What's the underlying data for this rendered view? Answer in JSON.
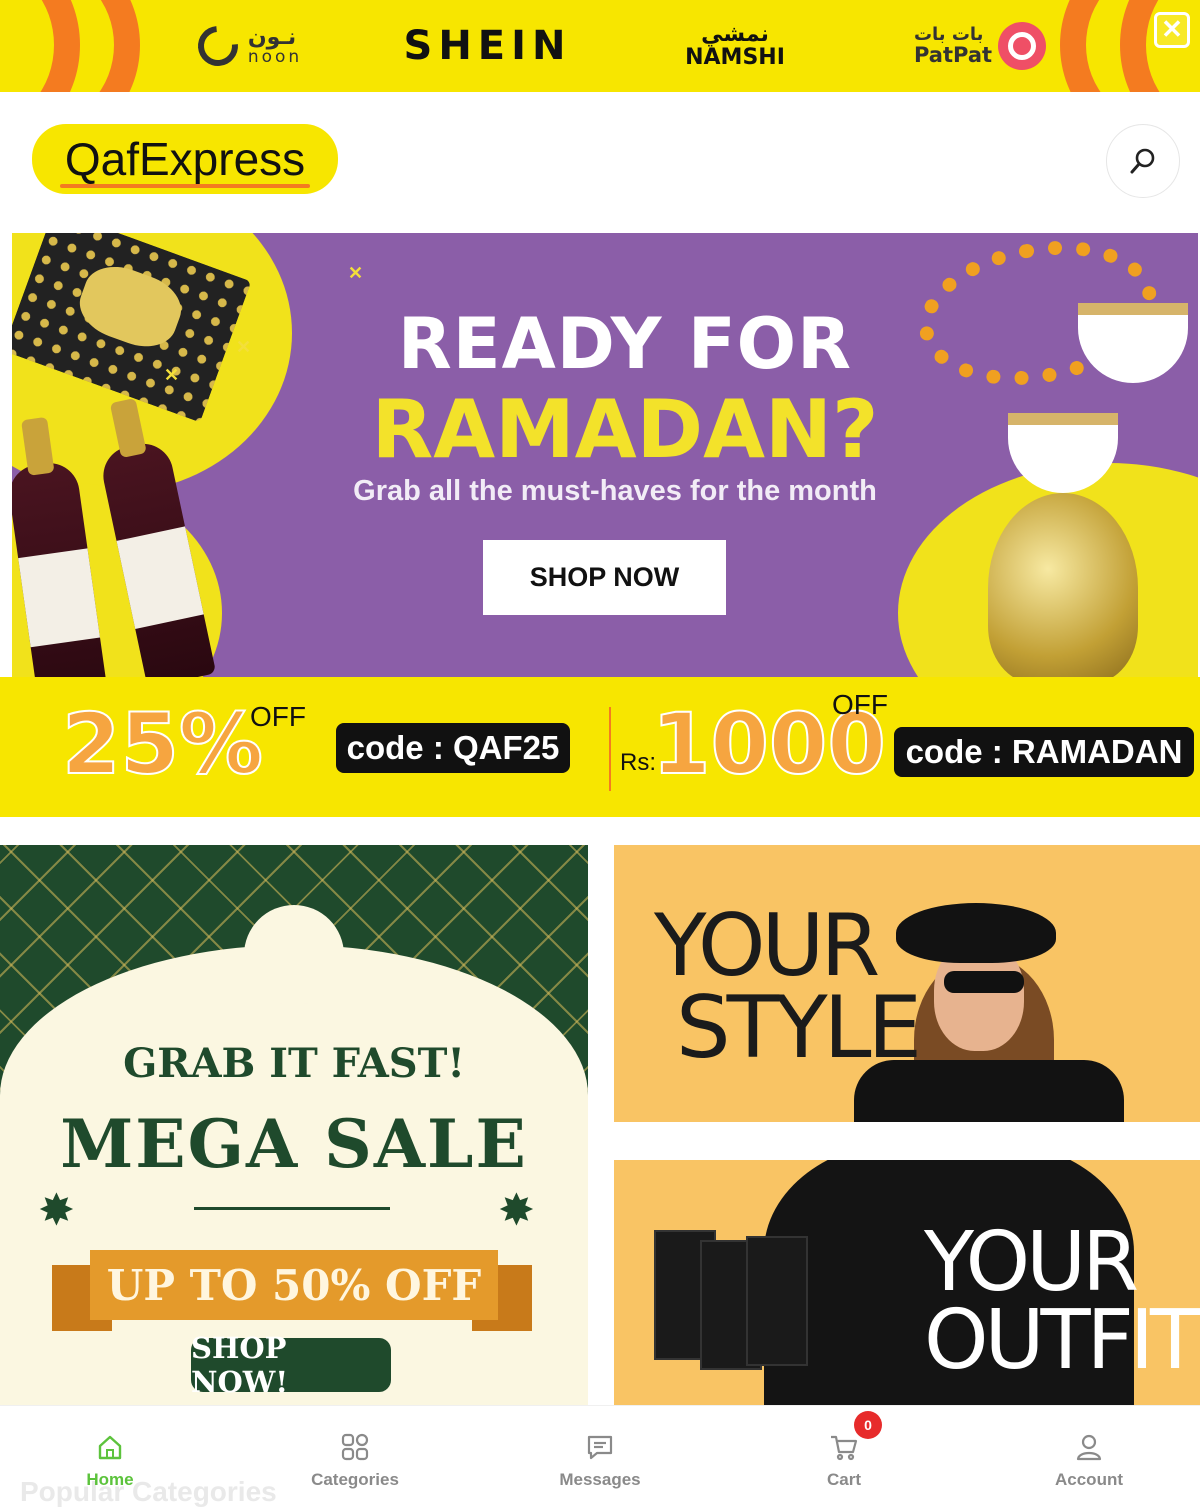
{
  "top_strip": {
    "brands": {
      "noon_ar": "نـون",
      "noon_en": "noon",
      "shein": "SHEIN",
      "namshi_ar": "نمشي",
      "namshi_en": "NAMSHI",
      "patpat_ar": "بات بات",
      "patpat_en": "PatPat"
    },
    "close_symbol": "✕"
  },
  "header": {
    "logo_text": "QafExpress",
    "search_icon": "search-icon"
  },
  "hero": {
    "title_line1": "READY FOR",
    "title_line2": "RAMADAN?",
    "subtitle": "Grab all the must-haves for the month",
    "button": "SHOP NOW"
  },
  "coupons": {
    "first": {
      "amount": "25%",
      "off": "OFF",
      "code": "code : QAF25"
    },
    "second": {
      "currency": "Rs:",
      "amount": "1000",
      "off": "OFF",
      "code": "code : RAMADAN"
    }
  },
  "mega_sale": {
    "tagline": "GRAB IT FAST!",
    "title": "MEGA SALE",
    "ribbon": "UP TO 50% OFF",
    "button": "SHOP NOW!"
  },
  "style_cards": {
    "card1_line1": "YOUR",
    "card1_line2": "STYLE",
    "card2_line1": "YOUR",
    "card2_line2": "OUTFIT"
  },
  "bottom_nav": {
    "ghost_text": "Popular Categories",
    "items": [
      {
        "label": "Home",
        "icon": "home-icon",
        "active": true
      },
      {
        "label": "Categories",
        "icon": "grid-icon",
        "active": false
      },
      {
        "label": "Messages",
        "icon": "message-icon",
        "active": false
      },
      {
        "label": "Cart",
        "icon": "cart-icon",
        "active": false,
        "badge": "0"
      },
      {
        "label": "Account",
        "icon": "user-icon",
        "active": false
      }
    ]
  },
  "colors": {
    "brand_yellow": "#f7e600",
    "accent_orange": "#f47b20",
    "hero_purple": "#8b5ea8",
    "active_green": "#5cc33c",
    "badge_red": "#e72b2b"
  }
}
